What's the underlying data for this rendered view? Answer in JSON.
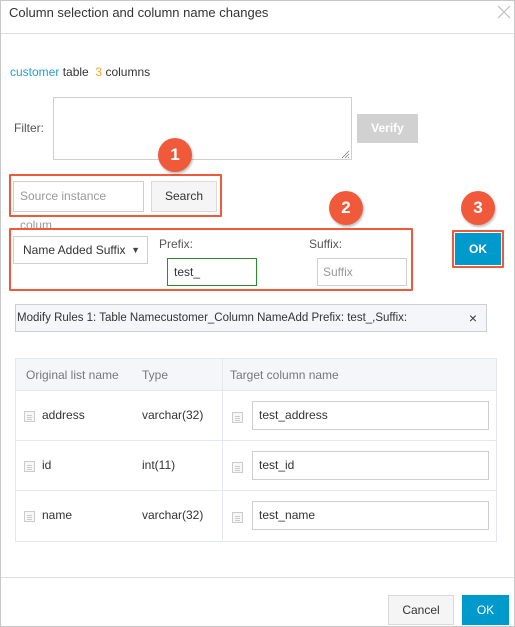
{
  "dialog": {
    "title": "Column selection and column name changes",
    "close_icon": "close-icon"
  },
  "summary": {
    "table_name": "customer",
    "table_word": "table",
    "column_count": "3",
    "columns_word": "columns"
  },
  "filter": {
    "label": "Filter:",
    "value": "",
    "verify_label": "Verify"
  },
  "search": {
    "placeholder": "Source instance colum",
    "button_label": "Search"
  },
  "rename": {
    "mode_selected": "Name Added Suffix",
    "caret": "▼",
    "prefix_label": "Prefix:",
    "prefix_value": "test_",
    "suffix_label": "Suffix:",
    "suffix_placeholder": "Suffix",
    "ok_label": "OK"
  },
  "annotations": {
    "badges": [
      "1",
      "2",
      "3"
    ],
    "highlight_color": "#f05a3a"
  },
  "rule": {
    "text": "Modify Rules 1:  Table Namecustomer_Column NameAdd Prefix:  test_,Suffix:",
    "remove_icon": "×"
  },
  "table": {
    "headers": [
      "Original list name",
      "Type",
      "Target column name"
    ],
    "rows": [
      {
        "original": "address",
        "type": "varchar(32)",
        "target": "test_address"
      },
      {
        "original": "id",
        "type": "int(11)",
        "target": "test_id"
      },
      {
        "original": "name",
        "type": "varchar(32)",
        "target": "test_name"
      }
    ]
  },
  "footer": {
    "cancel_label": "Cancel",
    "ok_label": "OK"
  },
  "colors": {
    "primary": "#0099cc",
    "link": "#1e9fd6",
    "count": "#f5a623",
    "active_input_border": "#2c8c2c"
  }
}
